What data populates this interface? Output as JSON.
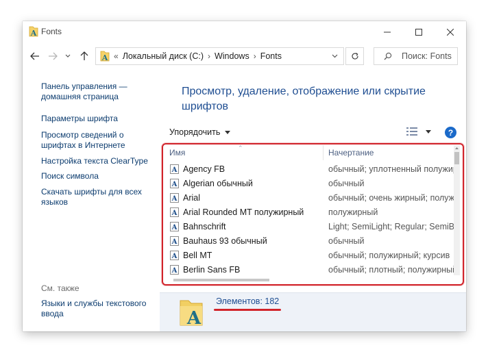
{
  "window": {
    "title": "Fonts",
    "controls": {
      "minimize": "minimize",
      "maximize": "maximize",
      "close": "close"
    }
  },
  "address": {
    "overflow": "«",
    "breadcrumbs": [
      "Локальный диск (C:)",
      "Windows",
      "Fonts"
    ],
    "separator": "›"
  },
  "search": {
    "placeholder": "Поиск: Fonts"
  },
  "sidebar": {
    "links": [
      "Панель управления — домашняя страница",
      "Параметры шрифта",
      "Просмотр сведений о шрифтах в Интернете",
      "Настройка текста ClearType",
      "Поиск символа",
      "Скачать шрифты для всех языков"
    ],
    "see_also_label": "См. также",
    "see_also_links": [
      "Языки и службы текстового ввода"
    ]
  },
  "main": {
    "heading": "Просмотр, удаление, отображение или скрытие шрифтов",
    "organize_label": "Упорядочить",
    "help_label": "?"
  },
  "table": {
    "columns": [
      "Имя",
      "Начертание"
    ],
    "rows": [
      {
        "name": "Agency FB",
        "style": "обычный; уплотненный полужирный"
      },
      {
        "name": "Algerian обычный",
        "style": "обычный"
      },
      {
        "name": "Arial",
        "style": "обычный; очень жирный; полужирный"
      },
      {
        "name": "Arial Rounded MT полужирный",
        "style": "полужирный"
      },
      {
        "name": "Bahnschrift",
        "style": "Light; SemiLight; Regular; SemiBold"
      },
      {
        "name": "Bauhaus 93 обычный",
        "style": "обычный"
      },
      {
        "name": "Bell MT",
        "style": "обычный; полужирный; курсив"
      },
      {
        "name": "Berlin Sans FB",
        "style": "обычный; плотный; полужирный"
      }
    ]
  },
  "details": {
    "count_label": "Элементов: 182"
  },
  "colors": {
    "highlight": "#d1232a",
    "link": "#0b3b6e",
    "heading": "#1e4d91",
    "details_bg": "#eef2f8"
  },
  "icons": {
    "app": "fonts-folder-icon",
    "back": "back-arrow-icon",
    "forward": "forward-arrow-icon",
    "recent": "chevron-down-icon",
    "up": "up-arrow-icon",
    "refresh": "refresh-icon",
    "search": "search-icon",
    "font_file": "font-file-icon",
    "view": "view-details-icon",
    "help": "help-icon"
  }
}
